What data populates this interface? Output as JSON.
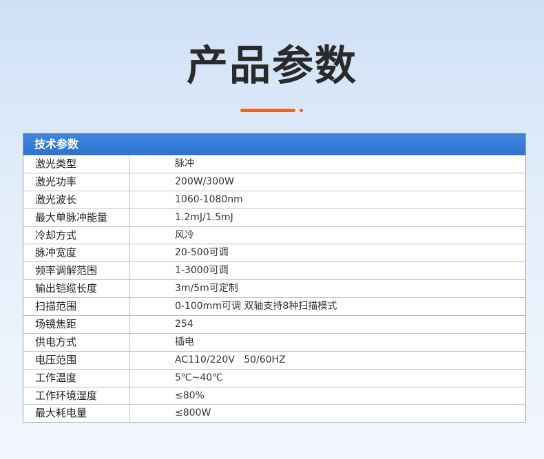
{
  "page": {
    "title": "产品参数"
  },
  "table": {
    "header": "技术参数",
    "rows": [
      {
        "label": "激光类型",
        "value": "脉冲"
      },
      {
        "label": "激光功率",
        "value": "200W/300W"
      },
      {
        "label": "激光波长",
        "value": "1060-1080nm"
      },
      {
        "label": "最大单脉冲能量",
        "value": "1.2mJ/1.5mJ"
      },
      {
        "label": "冷却方式",
        "value": "风冷"
      },
      {
        "label": "脉冲宽度",
        "value": "20-500可调"
      },
      {
        "label": "频率调解范围",
        "value": "1-3000可调"
      },
      {
        "label": "输出铠缆长度",
        "value": "3m/5m可定制"
      },
      {
        "label": "扫描范围",
        "value": "0-100mm可调 双轴支持8种扫描模式"
      },
      {
        "label": "场镜焦距",
        "value": "254"
      },
      {
        "label": "供电方式",
        "value": "插电"
      },
      {
        "label": "电压范围",
        "value": "AC110/220V   50/60HZ"
      },
      {
        "label": "工作温度",
        "value": "5℃~40℃"
      },
      {
        "label": "工作环境湿度",
        "value": "≤80%"
      },
      {
        "label": "最大耗电量",
        "value": "≤800W"
      }
    ]
  },
  "colors": {
    "accent": "#e8661f",
    "header_bg": "#3579d6",
    "background": "#dbe7f8"
  }
}
